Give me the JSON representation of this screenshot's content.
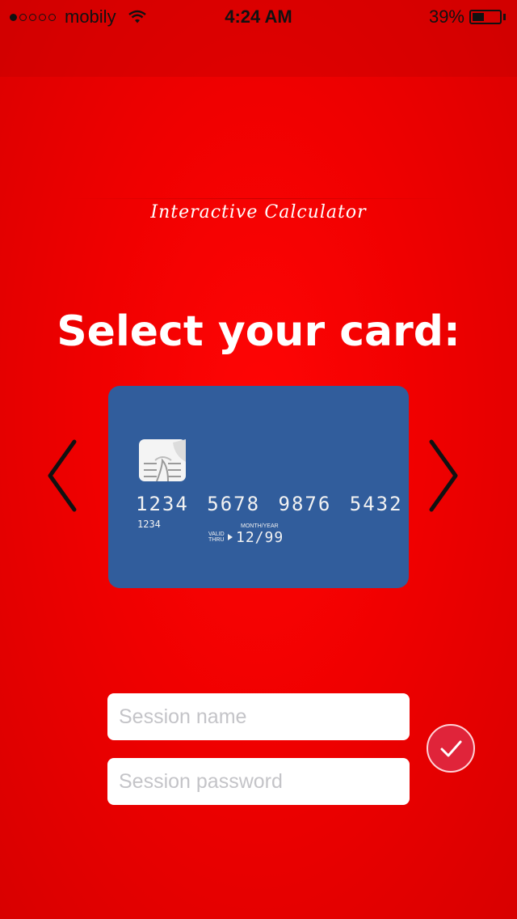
{
  "status_bar": {
    "carrier": "mobily",
    "signal_dots_filled": 1,
    "signal_dots_total": 5,
    "time": "4:24 AM",
    "battery_percent": "39%",
    "wifi_icon": "wifi-icon",
    "battery_icon": "battery-icon"
  },
  "app_title": "Interactive Calculator",
  "heading": "Select your card:",
  "carousel": {
    "prev_icon": "chevron-left-icon",
    "next_icon": "chevron-right-icon",
    "arrow_color": "#111111"
  },
  "card": {
    "number": "1234 5678 9876 5432",
    "sub_number": "1234",
    "month_year_label": "MONTH/YEAR",
    "valid_thru_label": "VALID THRU",
    "expiry": "12/99",
    "chip_icon": "card-chip-icon",
    "color": "#315d9c"
  },
  "form": {
    "session_name_placeholder": "Session name",
    "session_name_value": "",
    "session_password_placeholder": "Session password",
    "session_password_value": "",
    "submit_icon": "checkmark-icon",
    "submit_color": "#e0243a"
  },
  "colors": {
    "background": "#f00000",
    "text": "#ffffff"
  }
}
